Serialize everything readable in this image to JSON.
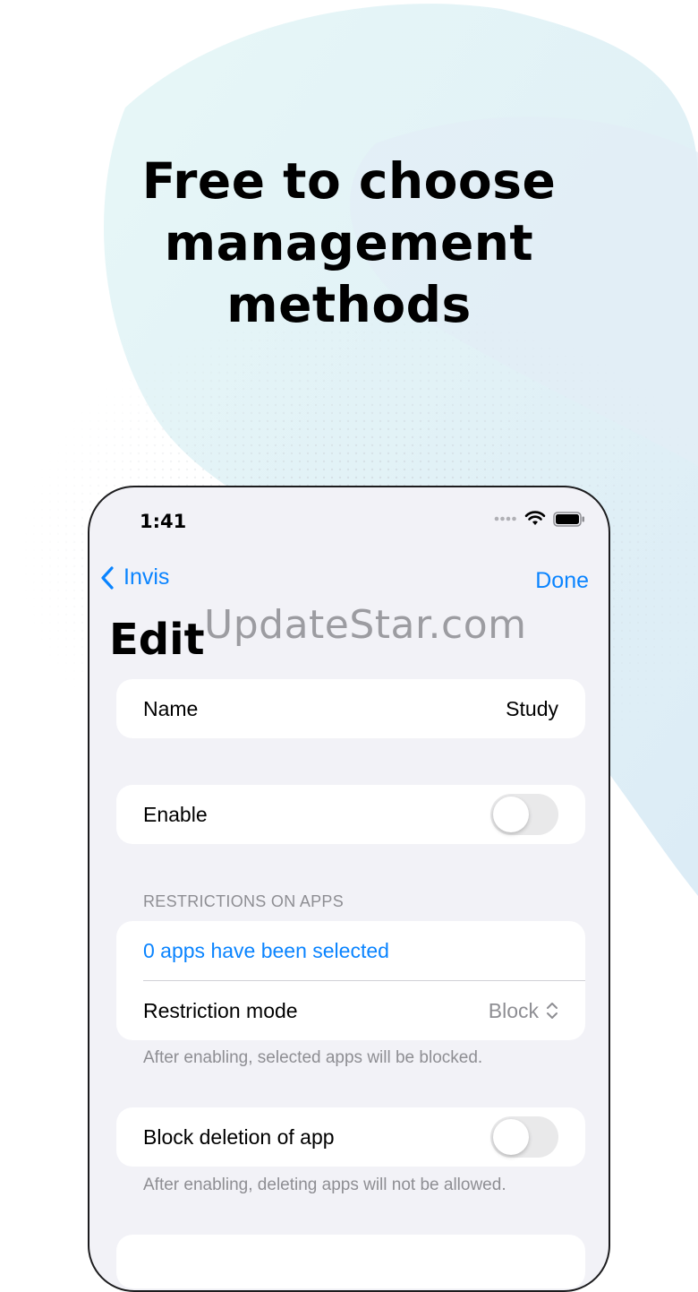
{
  "headline": {
    "line1": "Free to choose",
    "line2": "management",
    "line3": "methods"
  },
  "watermark": "UpdateStar.com",
  "status_bar": {
    "time": "1:41",
    "icons": [
      "signal-dots-icon",
      "wifi-icon",
      "battery-icon"
    ]
  },
  "nav": {
    "back_label": "Invis",
    "done_label": "Done"
  },
  "page_title": "Edit",
  "name_row": {
    "label": "Name",
    "value": "Study"
  },
  "enable_row": {
    "label": "Enable",
    "toggle_on": false
  },
  "restrictions": {
    "header": "RESTRICTIONS ON APPS",
    "apps_selected": "0 apps have been selected",
    "mode_label": "Restriction mode",
    "mode_value": "Block",
    "footnote": "After enabling, selected apps will be blocked."
  },
  "block_deletion": {
    "label": "Block deletion of app",
    "toggle_on": false,
    "footnote": "After enabling, deleting apps will not be allowed."
  },
  "colors": {
    "accent": "#0a84ff",
    "background_grouped": "#f2f2f7",
    "secondary_text": "#8e8e93"
  }
}
